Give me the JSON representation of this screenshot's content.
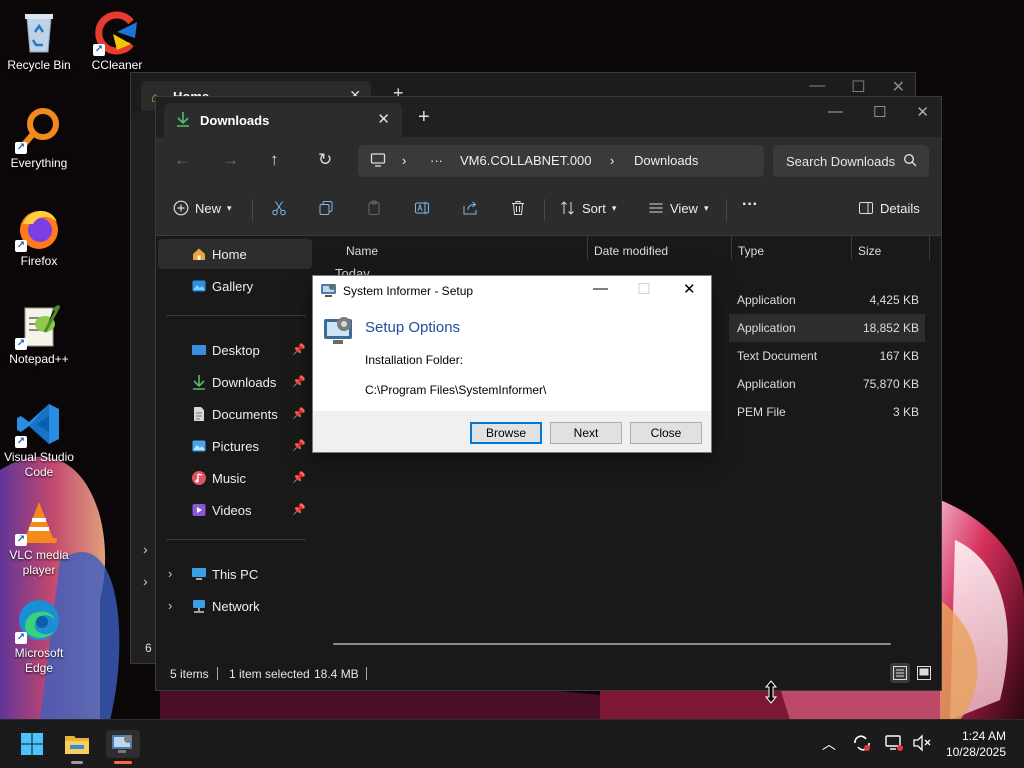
{
  "desktop": {
    "icons": [
      {
        "label": "Recycle Bin",
        "icon": "recycle-bin-icon"
      },
      {
        "label": "CCleaner",
        "icon": "ccleaner-icon"
      },
      {
        "label": "Everything",
        "icon": "everything-search-icon"
      },
      {
        "label": "Firefox",
        "icon": "firefox-icon"
      },
      {
        "label": "Notepad++",
        "icon": "notepad-plus-plus-icon"
      },
      {
        "label": "Visual Studio Code",
        "icon": "vscode-icon"
      },
      {
        "label": "VLC media player",
        "icon": "vlc-icon"
      },
      {
        "label": "Microsoft Edge",
        "icon": "edge-icon"
      }
    ]
  },
  "back_window": {
    "tab_title": "Home",
    "status_text": "6 i"
  },
  "explorer": {
    "tab_title": "Downloads",
    "new_tab": "+",
    "address": {
      "more": "···",
      "segments": [
        "VM6.COLLABNET.000",
        "Downloads"
      ]
    },
    "search_placeholder": "Search Downloads",
    "toolbar": {
      "new_label": "New",
      "sort_label": "Sort",
      "view_label": "View",
      "more_label": "···",
      "details_label": "Details"
    },
    "nav": {
      "home": "Home",
      "gallery": "Gallery",
      "desktop": "Desktop",
      "downloads": "Downloads",
      "documents": "Documents",
      "pictures": "Pictures",
      "music": "Music",
      "videos": "Videos",
      "this_pc": "This PC",
      "network": "Network"
    },
    "columns": {
      "name": "Name",
      "date_modified": "Date modified",
      "type": "Type",
      "size": "Size"
    },
    "group_label": "Today",
    "files": [
      {
        "type": "Application",
        "size": "4,425 KB",
        "selected": false
      },
      {
        "type": "Application",
        "size": "18,852 KB",
        "selected": true
      },
      {
        "type": "Text Document",
        "size": "167 KB",
        "selected": false
      },
      {
        "type": "Application",
        "size": "75,870 KB",
        "selected": false
      },
      {
        "type": "PEM File",
        "size": "3 KB",
        "selected": false
      }
    ],
    "status": {
      "items": "5 items",
      "selected": "1 item selected",
      "size": "18.4 MB"
    }
  },
  "dialog": {
    "title": "System Informer - Setup",
    "heading": "Setup Options",
    "folder_label": "Installation Folder:",
    "folder_path": "C:\\Program Files\\SystemInformer\\",
    "browse": "Browse",
    "next": "Next",
    "close": "Close"
  },
  "taskbar": {
    "time": "1:24 AM",
    "date": "10/28/2025"
  },
  "colors": {
    "accent": "#0078d7",
    "dialog_heading": "#1f4e9b",
    "explorer_bg": "#191919"
  }
}
